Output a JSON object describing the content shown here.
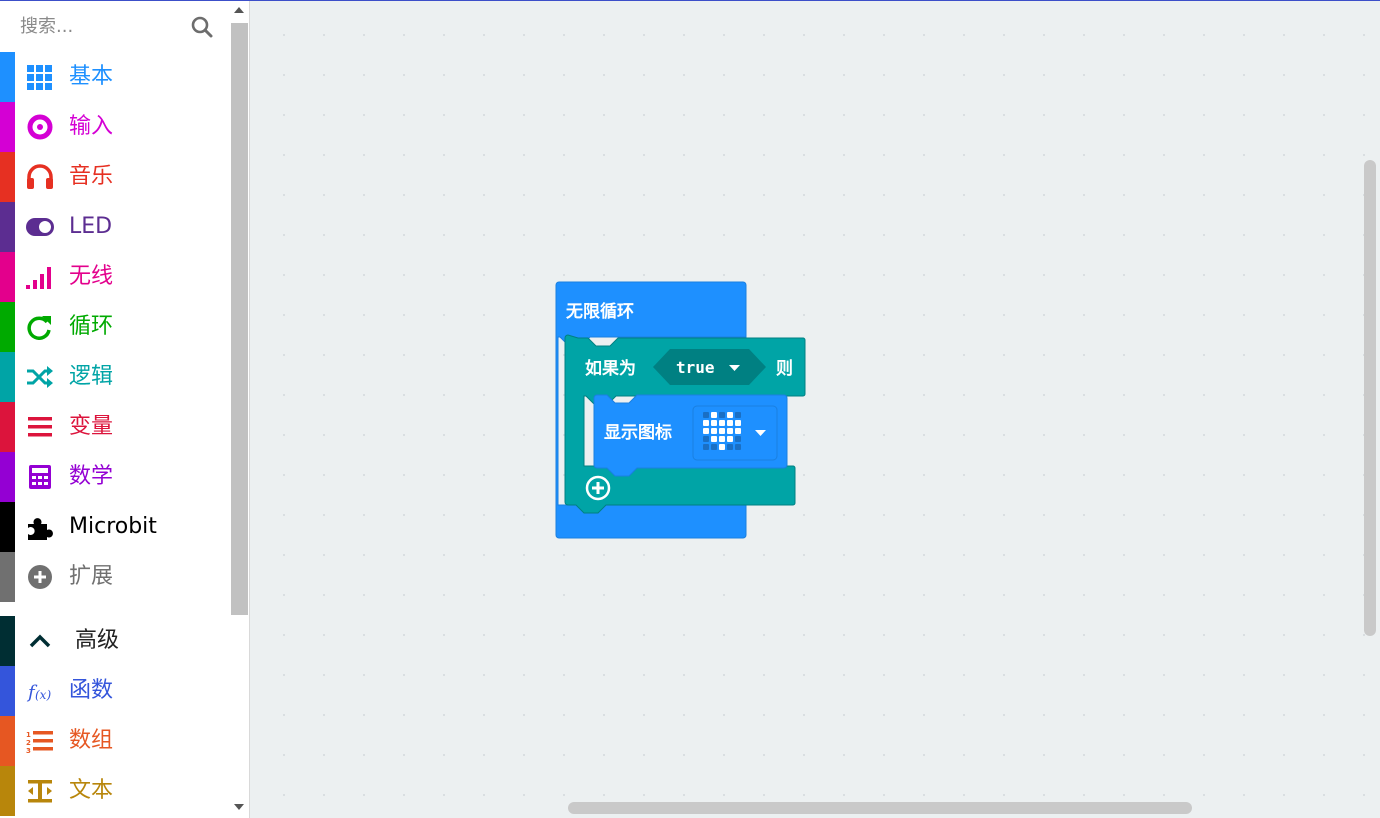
{
  "search": {
    "placeholder": "搜索..."
  },
  "categories": [
    {
      "label": "基本",
      "icon": "grid-icon",
      "color": "#1e90ff"
    },
    {
      "label": "输入",
      "icon": "circle-dot-icon",
      "color": "#d400d4"
    },
    {
      "label": "音乐",
      "icon": "headphones-icon",
      "color": "#e63022"
    },
    {
      "label": "LED",
      "icon": "toggle-icon",
      "color": "#5c2d91"
    },
    {
      "label": "无线",
      "icon": "signal-bars-icon",
      "color": "#e3008c"
    },
    {
      "label": "循环",
      "icon": "refresh-icon",
      "color": "#00aa00"
    },
    {
      "label": "逻辑",
      "icon": "shuffle-icon",
      "color": "#00a4a6"
    },
    {
      "label": "变量",
      "icon": "list-lines-icon",
      "color": "#dc143c"
    },
    {
      "label": "数学",
      "icon": "calculator-icon",
      "color": "#9400d3"
    },
    {
      "label": "Microbit",
      "icon": "puzzle-icon",
      "color": "#000000"
    },
    {
      "label": "扩展",
      "icon": "plus-circle-icon",
      "color": "#707070"
    }
  ],
  "advanced": {
    "label": "高级",
    "icon": "chevron-up-icon",
    "color": "#002e33"
  },
  "advanced_categories": [
    {
      "label": "函数",
      "icon": "function-icon",
      "color": "#3455db"
    },
    {
      "label": "数组",
      "icon": "numbered-list-icon",
      "color": "#e65722"
    },
    {
      "label": "文本",
      "icon": "text-icon",
      "color": "#b8860b"
    }
  ],
  "blocks": {
    "forever_label": "无限循环",
    "if_label": "如果为",
    "condition_value": "true",
    "then_label": "则",
    "show_icon_label": "显示图标",
    "icon_value": "heart",
    "colors": {
      "basic": "#1e90ff",
      "logic": "#00a4a6",
      "logic_dark": "#008082",
      "basic_dark": "#1a7fe0"
    }
  }
}
